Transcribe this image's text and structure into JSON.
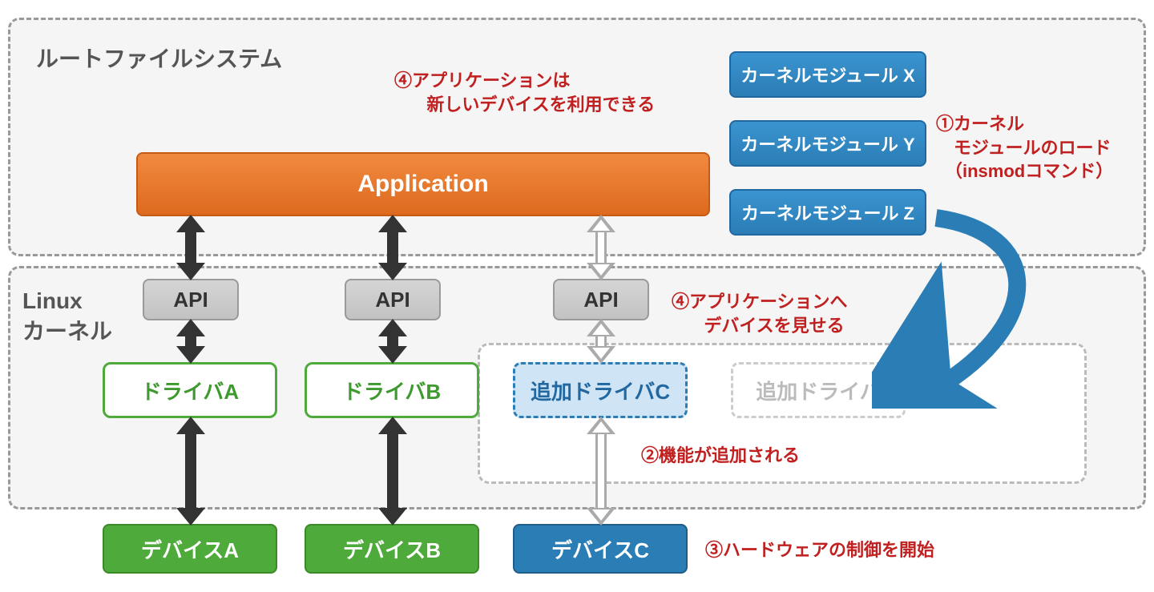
{
  "rootfs": {
    "label": "ルートファイルシステム"
  },
  "kernel": {
    "label": "Linux\nカーネル"
  },
  "application": {
    "label": "Application"
  },
  "api": {
    "a": "API",
    "b": "API",
    "c": "API"
  },
  "drivers": {
    "a": "ドライバA",
    "b": "ドライバB",
    "added_c": "追加ドライバC",
    "added_ghost": "追加ドライバ"
  },
  "devices": {
    "a": "デバイスA",
    "b": "デバイスB",
    "c": "デバイスC"
  },
  "modules": {
    "x": "カーネルモジュール X",
    "y": "カーネルモジュール Y",
    "z": "カーネルモジュール Z"
  },
  "notes": {
    "n1": "①カーネル\n　モジュールのロード\n　（insmodコマンド）",
    "n2": "②機能が追加される",
    "n3": "③ハードウェアの制御を開始",
    "n4_top": "④アプリケーションは\n　   新しいデバイスを利用できる",
    "n4_mid": "④アプリケーションへ\n　   デバイスを見せる"
  },
  "colors": {
    "orange": "#e8752a",
    "green": "#4eaa3a",
    "blue": "#2b7db5",
    "red": "#c02020",
    "grey": "#999"
  }
}
